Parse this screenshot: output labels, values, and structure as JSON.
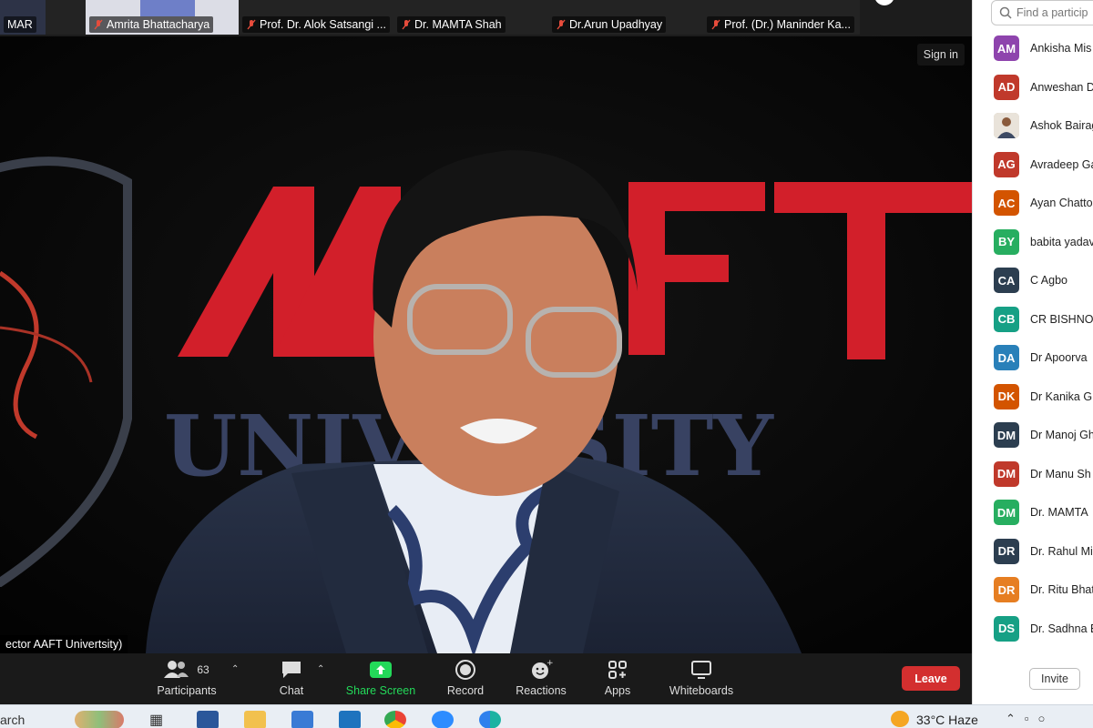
{
  "top_strip": {
    "thumbs": [
      {
        "name": "MAR"
      },
      {
        "name": "Amrita Bhattacharya"
      },
      {
        "name": "Prof. Dr. Alok Satsangi ..."
      },
      {
        "name": "Dr. MAMTA Shah"
      },
      {
        "name": "Dr.Arun Upadhyay"
      },
      {
        "name": "Prof. (Dr.) Maninder Ka..."
      }
    ]
  },
  "main_video": {
    "sign_in": "Sign in",
    "caption": "ector AAFT Univertsity)",
    "background_brand": "AAFT",
    "background_sub": "UNIVERSITY"
  },
  "toolbar": {
    "participants_label": "Participants",
    "participants_count": "63",
    "chat_label": "Chat",
    "share_label": "Share Screen",
    "record_label": "Record",
    "reactions_label": "Reactions",
    "apps_label": "Apps",
    "whiteboards_label": "Whiteboards",
    "leave_label": "Leave",
    "share_color": "#23d959",
    "leave_color": "#d32f2f"
  },
  "participants_panel": {
    "search_placeholder": "Find a particip",
    "invite_label": "Invite",
    "items": [
      {
        "initials": "AM",
        "name": "Ankisha Mis",
        "color": "#8e44ad"
      },
      {
        "initials": "AD",
        "name": "Anweshan D",
        "color": "#c0392b"
      },
      {
        "initials": "",
        "name": "Ashok Bairag",
        "color": "#c9b7a0",
        "photo": true
      },
      {
        "initials": "AG",
        "name": "Avradeep Ga",
        "color": "#c0392b"
      },
      {
        "initials": "AC",
        "name": "Ayan Chatto",
        "color": "#d35400"
      },
      {
        "initials": "BY",
        "name": "babita yadav",
        "color": "#27ae60"
      },
      {
        "initials": "CA",
        "name": "C Agbo",
        "color": "#2c3e50"
      },
      {
        "initials": "CB",
        "name": "CR BISHNOI",
        "color": "#16a085"
      },
      {
        "initials": "DA",
        "name": "Dr Apoorva",
        "color": "#2980b9"
      },
      {
        "initials": "DK",
        "name": "Dr Kanika G",
        "color": "#d35400"
      },
      {
        "initials": "DM",
        "name": "Dr Manoj Gh",
        "color": "#2c3e50"
      },
      {
        "initials": "DM",
        "name": "Dr Manu Sh",
        "color": "#c0392b"
      },
      {
        "initials": "DM",
        "name": "Dr. MAMTA",
        "color": "#27ae60"
      },
      {
        "initials": "DR",
        "name": "Dr. Rahul Mi",
        "color": "#2c3e50"
      },
      {
        "initials": "DR",
        "name": "Dr. Ritu Bhat",
        "color": "#e67e22"
      },
      {
        "initials": "DS",
        "name": "Dr. Sadhna B",
        "color": "#16a085"
      }
    ]
  },
  "taskbar": {
    "search_text": "arch",
    "weather": "33°C  Haze"
  }
}
